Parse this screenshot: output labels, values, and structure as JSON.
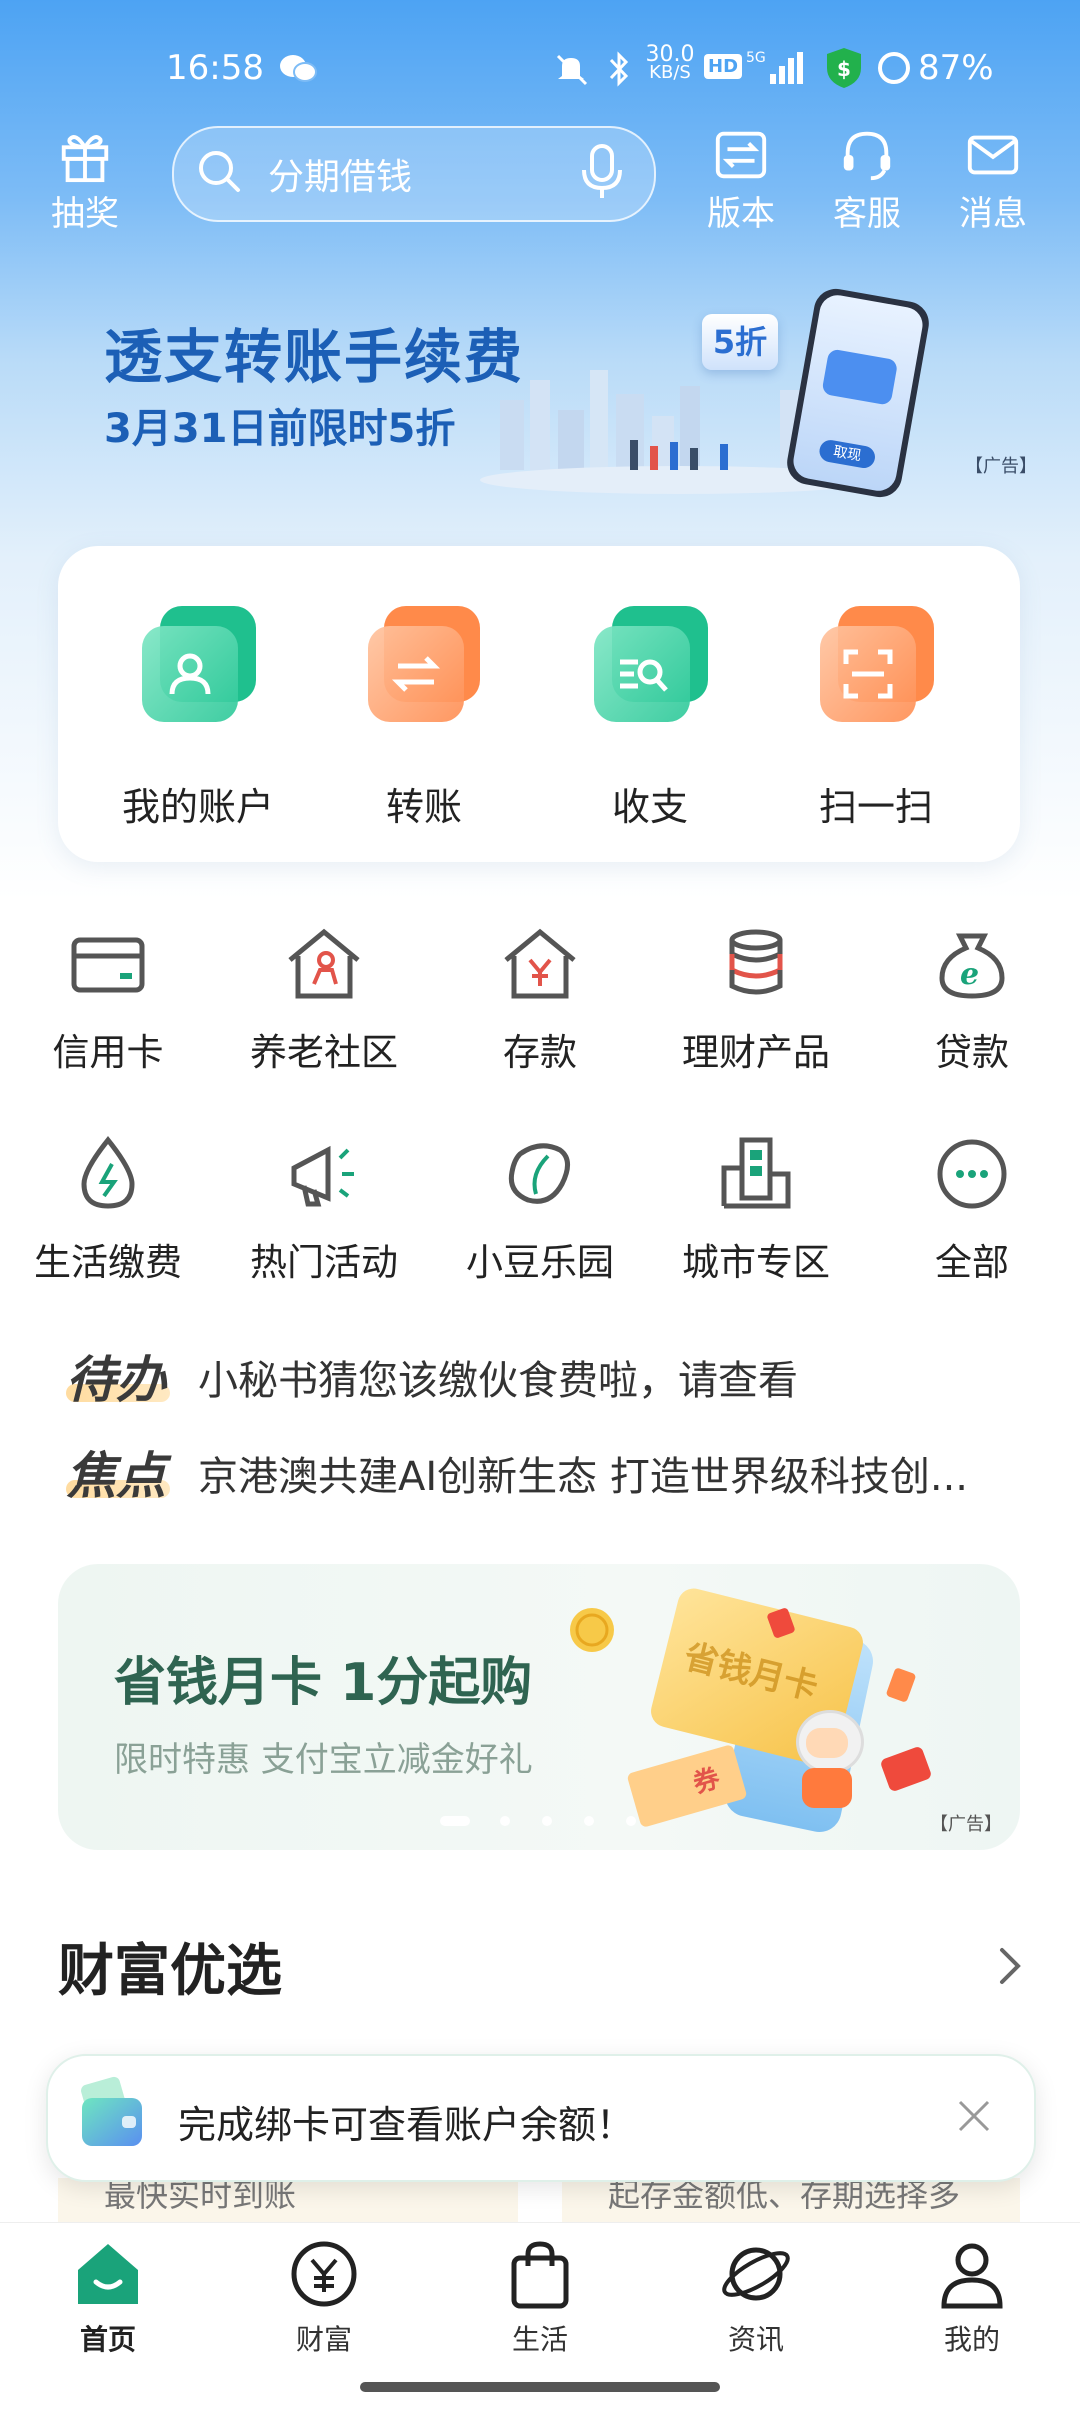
{
  "status_bar": {
    "time": "16:58",
    "net_speed_top": "30.0",
    "net_speed_unit": "KB/S",
    "hd": "HD",
    "signal": "5G",
    "battery": "87%"
  },
  "header": {
    "lottery_label": "抽奖",
    "search_placeholder": "分期借钱",
    "version_label": "版本",
    "service_label": "客服",
    "message_label": "消息"
  },
  "banner": {
    "title": "透支转账手续费",
    "subtitle": "3月31日前限时5折",
    "discount_badge": "5折",
    "phone_button": "取现",
    "ad_tag": "【广告】"
  },
  "quick_actions": [
    {
      "label": "我的账户",
      "icon": "account-icon",
      "color": "#1fc08e"
    },
    {
      "label": "转账",
      "icon": "transfer-icon",
      "color": "#ff7a3d"
    },
    {
      "label": "收支",
      "icon": "income-expense-icon",
      "color": "#1fc08e"
    },
    {
      "label": "扫一扫",
      "icon": "scan-icon",
      "color": "#ff7a3d"
    }
  ],
  "services_row1": [
    {
      "label": "信用卡",
      "icon": "credit-card-icon"
    },
    {
      "label": "养老社区",
      "icon": "elderly-community-icon"
    },
    {
      "label": "存款",
      "icon": "deposit-icon"
    },
    {
      "label": "理财产品",
      "icon": "wealth-products-icon"
    },
    {
      "label": "贷款",
      "icon": "loan-icon"
    }
  ],
  "services_row2": [
    {
      "label": "生活缴费",
      "icon": "utility-payment-icon"
    },
    {
      "label": "热门活动",
      "icon": "hot-activity-icon"
    },
    {
      "label": "小豆乐园",
      "icon": "bean-park-icon"
    },
    {
      "label": "城市专区",
      "icon": "city-zone-icon"
    },
    {
      "label": "全部",
      "icon": "more-icon"
    }
  ],
  "ticker": {
    "todo_tag": "待办",
    "todo_text": "小秘书猜您该缴伙食费啦，请查看",
    "focus_tag": "焦点",
    "focus_text": "京港澳共建AI创新生态 打造世界级科技创..."
  },
  "promo": {
    "title": "省钱月卡 1分起购",
    "subtitle": "限时特惠 支付宝立减金好礼",
    "card_text": "省钱月卡",
    "ticket_text": "券",
    "ad_tag": "【广告】"
  },
  "wealth": {
    "title": "财富优选"
  },
  "toast": {
    "text": "完成绑卡可查看账户余额！"
  },
  "peek": {
    "left": "最快实时到账",
    "right": "起存金额低、存期选择多"
  },
  "bottom_nav": [
    {
      "label": "首页",
      "icon": "home-icon",
      "active": true
    },
    {
      "label": "财富",
      "icon": "wealth-icon",
      "active": false
    },
    {
      "label": "生活",
      "icon": "life-icon",
      "active": false
    },
    {
      "label": "资讯",
      "icon": "news-icon",
      "active": false
    },
    {
      "label": "我的",
      "icon": "profile-icon",
      "active": false
    }
  ],
  "colors": {
    "brand_green": "#1aa37a",
    "accent_orange": "#ff7a3d",
    "banner_blue": "#1c5fb6",
    "icon_gray": "#555555",
    "icon_red": "#e2544a"
  }
}
